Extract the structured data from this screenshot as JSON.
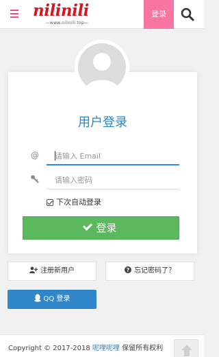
{
  "header": {
    "menu_icon": "hamburger-icon",
    "logo_text": "nilinili",
    "logo_subtext": "—www.nilinili.top—",
    "login_label": "登录",
    "search_icon": "search-icon",
    "accent": "#f874a1"
  },
  "login_card": {
    "title": "用户登录",
    "email": {
      "icon": "@",
      "placeholder": "请输入 Email",
      "value": ""
    },
    "password": {
      "icon": "key-icon",
      "placeholder": "请输入密码",
      "value": ""
    },
    "remember": {
      "label": "下次自动登录",
      "checked": true
    },
    "submit_label": "登录",
    "submit_color": "#5cb85c"
  },
  "actions": {
    "register_label": "注册新用户",
    "forgot_label": "忘记密码了？",
    "qq_label": "QQ 登录",
    "qq_color": "#2f86c8"
  },
  "footer": {
    "copyright": "Copyright © 2017-2018",
    "site_name": "呢哩呢哩",
    "rights": "保留所有权利"
  }
}
